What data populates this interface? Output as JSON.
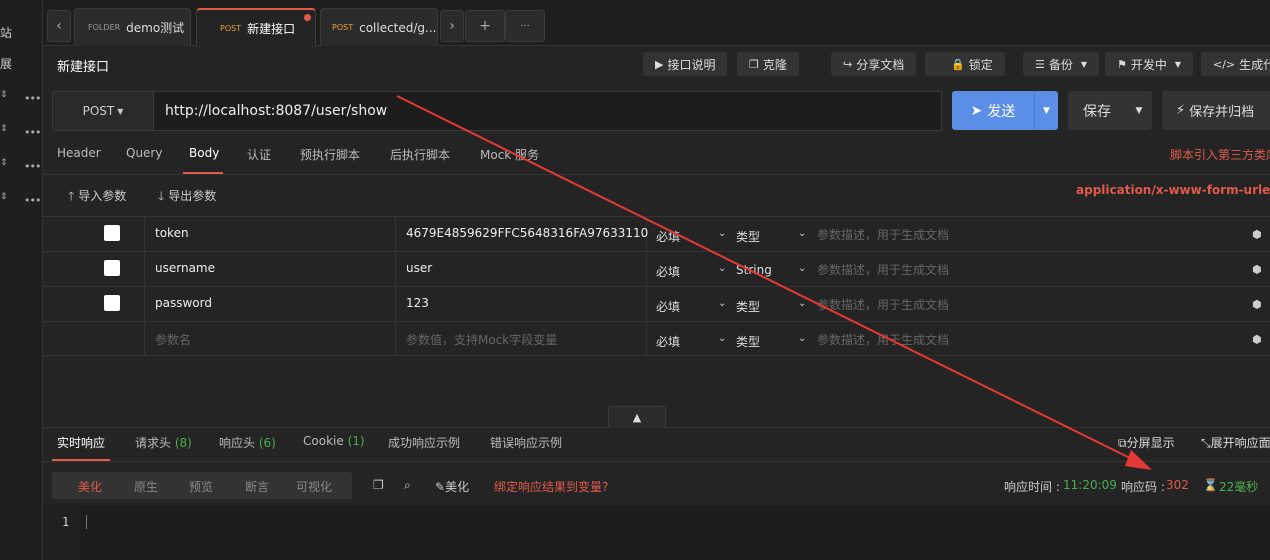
{
  "left_strip": {
    "text1": "站",
    "text2": "展",
    "rows": [
      {
        "updown": "⇕",
        "dots": "•••"
      },
      {
        "updown": "⇕",
        "dots": "•••"
      },
      {
        "updown": "⇕",
        "dots": "•••"
      },
      {
        "updown": "⇕",
        "dots": "•••"
      }
    ]
  },
  "tabs": [
    {
      "method": "FOLDER",
      "title": "demo测试"
    },
    {
      "method": "POST",
      "title": "新建接口"
    },
    {
      "method": "POST",
      "title": "collected/g..."
    }
  ],
  "tabbar": {
    "prev": "‹",
    "next": "›",
    "add": "+",
    "more": "···"
  },
  "page_title": "新建接口",
  "toolbar": {
    "doc": "接口说明",
    "clone": "克隆",
    "share": "分享文档",
    "lock": "锁定",
    "backup": "备份",
    "status": "开发中",
    "codegen": "生成代码"
  },
  "request": {
    "method": "POST",
    "url": "http://localhost:8087/user/show",
    "send": "发送",
    "save": "保存",
    "save_archive": "保存并归档"
  },
  "req_tabs": [
    "Header",
    "Query",
    "Body",
    "认证",
    "预执行脚本",
    "后执行脚本",
    "Mock 服务"
  ],
  "script_link": "脚本引入第三方类库",
  "import_params": "导入参数",
  "export_params": "导出参数",
  "content_type": "application/x-www-form-urlencoded",
  "params": [
    {
      "key": "token",
      "value": "4679E4859629FFC5648316FA97633110",
      "required": "必填",
      "type": "类型",
      "desc": "参数描述，用于生成文档"
    },
    {
      "key": "username",
      "value": "user",
      "required": "必填",
      "type": "String",
      "desc": "参数描述，用于生成文档"
    },
    {
      "key": "password",
      "value": "123",
      "required": "必填",
      "type": "类型",
      "desc": "参数描述，用于生成文档"
    }
  ],
  "new_param": {
    "key_placeholder": "参数名",
    "value_placeholder": "参数值，支持Mock字段变量",
    "required": "必填",
    "type": "类型",
    "desc": "参数描述，用于生成文档"
  },
  "resp_tabs": {
    "realtime": "实时响应",
    "req_headers": "请求头",
    "req_headers_count": "(8)",
    "resp_headers": "响应头",
    "resp_headers_count": "(6)",
    "cookie": "Cookie",
    "cookie_count": "(1)",
    "success_example": "成功响应示例",
    "error_example": "错误响应示例",
    "split": "分屏显示",
    "expand": "展开响应面板"
  },
  "view_modes": [
    "美化",
    "原生",
    "预览",
    "断言",
    "可视化"
  ],
  "beautify": "美化",
  "bind_result": "绑定响应结果到变量?",
  "resp_time_label": "响应时间 :",
  "resp_time": "11:20:09",
  "resp_code_label": "响应码 :",
  "resp_code": "302",
  "duration": "22毫秒",
  "line_number": "1",
  "colors": {
    "accent": "#e05a4a",
    "send": "#5b8ee6",
    "success": "#4caf50",
    "post": "#e8a23d"
  }
}
